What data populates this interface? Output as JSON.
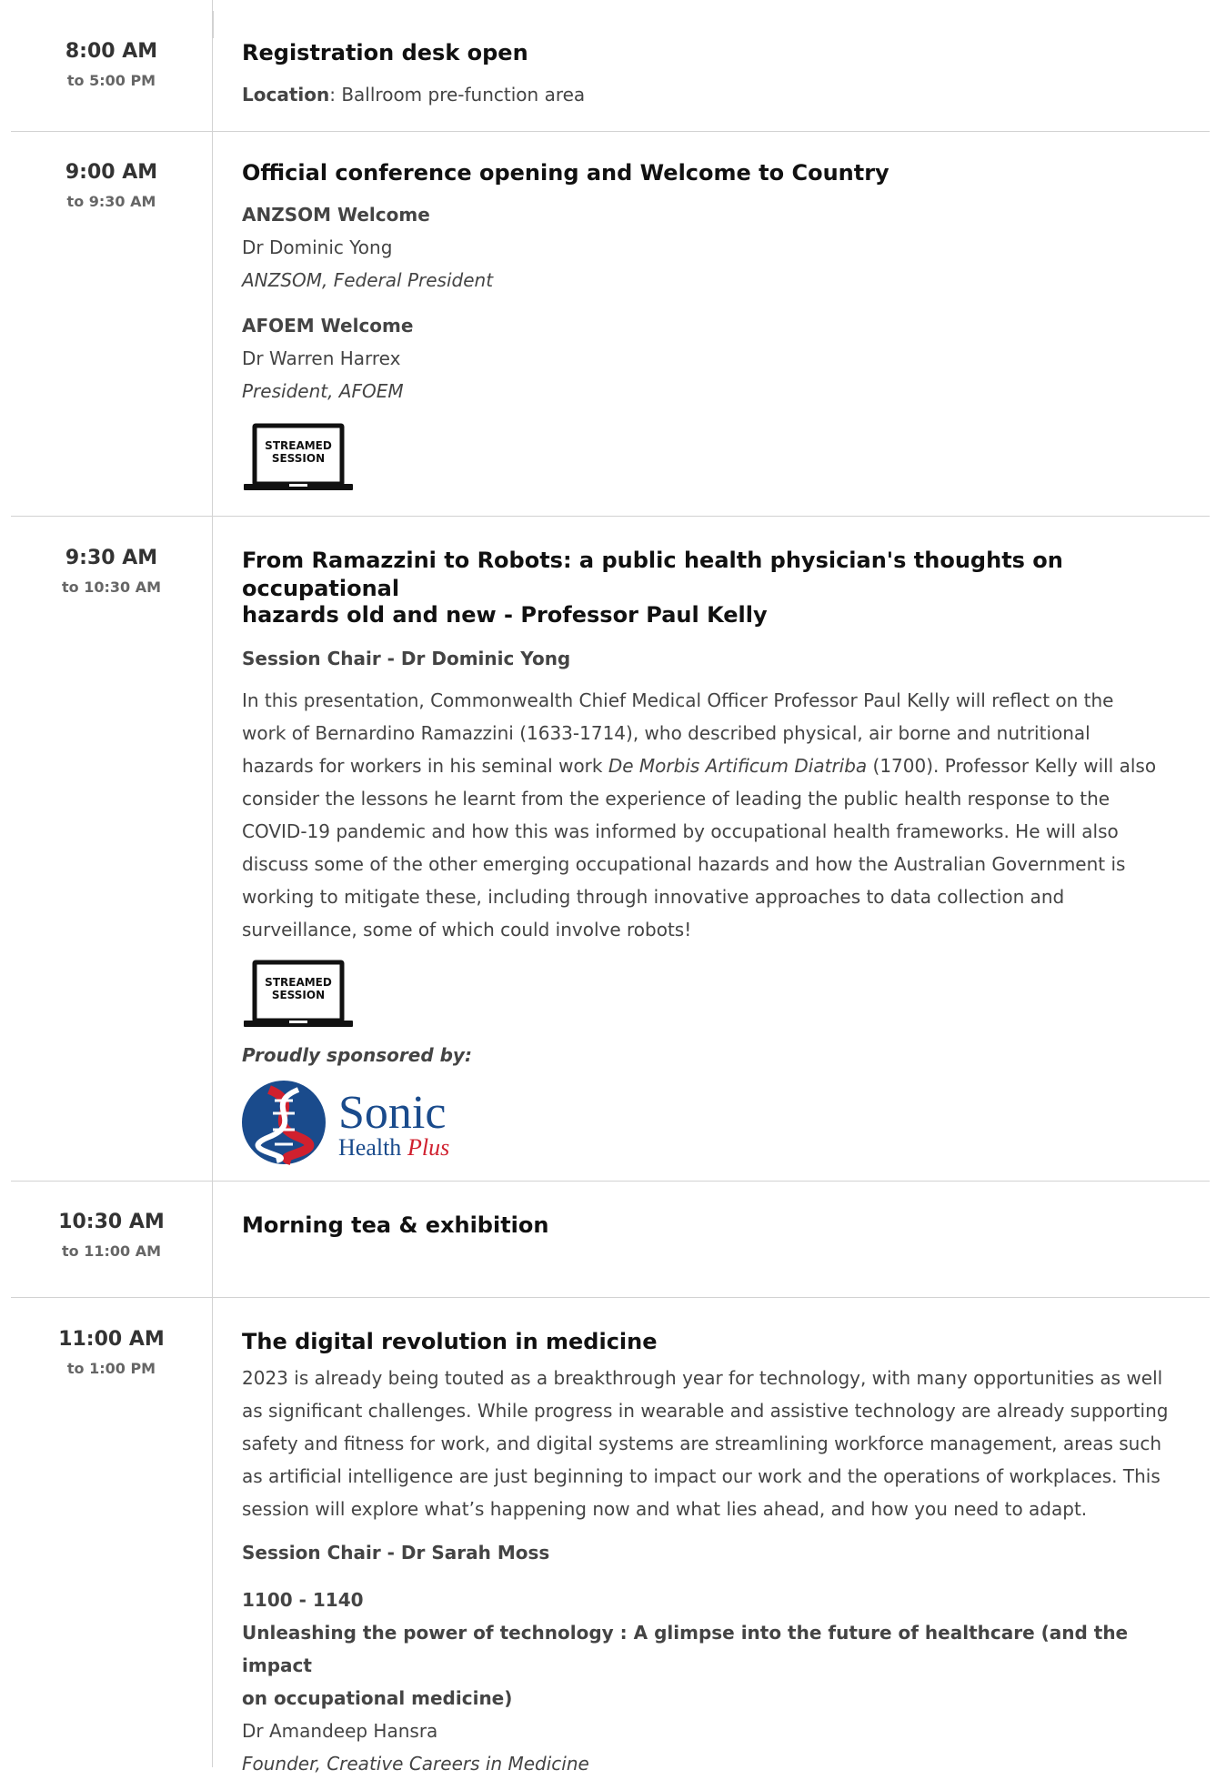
{
  "sessions": [
    {
      "start": "8:00 AM",
      "end": "to 5:00 PM",
      "title": "Registration desk open",
      "location_label": "Location",
      "location_value": ": Ballroom pre-function area"
    },
    {
      "start": "9:00 AM",
      "end": "to 9:30 AM",
      "title": "Official conference opening and Welcome to Country",
      "welcomes": [
        {
          "heading": "ANZSOM Welcome",
          "name": "Dr Dominic Yong",
          "role": "ANZSOM, Federal President"
        },
        {
          "heading": "AFOEM Welcome",
          "name": "Dr Warren Harrex",
          "role": "President, AFOEM"
        }
      ],
      "badge_line1": "STREAMED",
      "badge_line2": "SESSION"
    },
    {
      "start": "9:30 AM",
      "end": "to 10:30 AM",
      "title_line1": "From Ramazzini to Robots: a public health physician's thoughts on occupational",
      "title_line2": "hazards old and new - Professor Paul Kelly",
      "chair": "Session Chair - Dr Dominic Yong",
      "description_lines": [
        "In this presentation, Commonwealth Chief Medical Officer Professor Paul Kelly will reflect on the",
        "work of Bernardino Ramazzini (1633-1714), who described physical, air borne and nutritional",
        "hazards for workers in his seminal work ",
        "De Morbis Artificum Diatriba",
        " (1700).  Professor Kelly will also",
        "consider the lessons he learnt from the experience of leading the public health response to the",
        "COVID-19 pandemic and how this was informed by occupational health frameworks. He will also",
        "discuss some of the other emerging occupational hazards and how the Australian Government is",
        "working to mitigate these, including through innovative approaches to data collection and",
        "surveillance, some of which could involve robots!"
      ],
      "badge_line1": "STREAMED",
      "badge_line2": "SESSION",
      "sponsor_text": "Proudly sponsored by:",
      "sponsor_logo": {
        "word1": "Sonic",
        "word2": "Health",
        "word3": "Plus",
        "blue": "#1a4b8c",
        "red": "#d0202e"
      }
    },
    {
      "start": "10:30 AM",
      "end": "to 11:00 AM",
      "title": "Morning tea & exhibition"
    },
    {
      "start": "11:00 AM",
      "end": "to 1:00 PM",
      "title": "The digital revolution in medicine",
      "description_lines": [
        "2023 is already being touted as a breakthrough year for technology, with many opportunities as well",
        "as significant challenges. While progress in wearable and assistive technology are already supporting",
        "safety and fitness for work, and digital systems are streamlining workforce management, areas such",
        "as artificial intelligence are just beginning to impact our work and the operations of workplaces. This",
        "session will explore what’s happening now and what lies ahead, and how you need to adapt."
      ],
      "chair": "Session Chair - Dr Sarah Moss",
      "talk_time": "1100 - 1140",
      "talk_title_line1": "Unleashing the power of technology : A glimpse into the future of healthcare (and the impact",
      "talk_title_line2": "on occupational medicine)",
      "speaker": "Dr Amandeep Hansra",
      "speaker_role": "Founder, Creative Careers in Medicine"
    }
  ]
}
